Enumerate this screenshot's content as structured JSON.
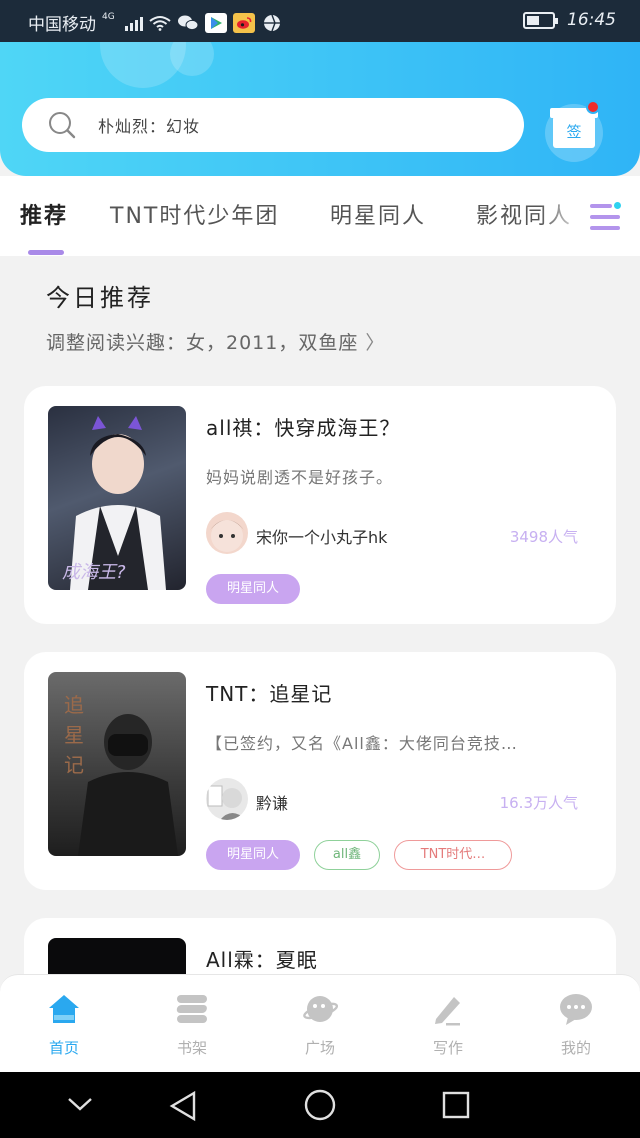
{
  "status_bar": {
    "carrier": "中国移动",
    "network": "4G",
    "time": "16:45"
  },
  "search": {
    "placeholder": "朴灿烈：幻妆"
  },
  "sign_in": {
    "label": "签"
  },
  "tabs": [
    {
      "label": "推荐",
      "active": true
    },
    {
      "label": "TNT时代少年团",
      "active": false
    },
    {
      "label": "明星同人",
      "active": false
    },
    {
      "label": "影视同人",
      "active": false
    }
  ],
  "recommend": {
    "title": "今日推荐",
    "subtitle": "调整阅读兴趣：女，2011，双鱼座",
    "chevron": "〉"
  },
  "books": [
    {
      "title": "all祺：快穿成海王？",
      "desc": "妈妈说剧透不是好孩子。",
      "author": "宋你一个小丸子hk",
      "popularity": "3498人气",
      "tags": [
        {
          "label": "明星同人",
          "style": "fill"
        }
      ]
    },
    {
      "title": "TNT：追星记",
      "desc": "【已签约，又名《All鑫：大佬同台竞技…",
      "author": "黔谦",
      "popularity": "16.3万人气",
      "tags": [
        {
          "label": "明星同人",
          "style": "fill"
        },
        {
          "label": "all鑫",
          "style": "green"
        },
        {
          "label": "TNT时代…",
          "style": "red"
        }
      ]
    },
    {
      "title": "All霖：夏眠"
    }
  ],
  "bottom_nav": [
    {
      "label": "首页",
      "icon": "home-icon",
      "active": true
    },
    {
      "label": "书架",
      "icon": "bookshelf-icon",
      "active": false
    },
    {
      "label": "广场",
      "icon": "planet-icon",
      "active": false
    },
    {
      "label": "写作",
      "icon": "pencil-icon",
      "active": false
    },
    {
      "label": "我的",
      "icon": "chat-bubble-icon",
      "active": false
    }
  ],
  "colors": {
    "header_start": "#4fd6f6",
    "header_end": "#2fb4f6",
    "accent_purple": "#a98ae8",
    "tag_purple": "#c9a5f0",
    "active_blue": "#2aa8ef"
  }
}
